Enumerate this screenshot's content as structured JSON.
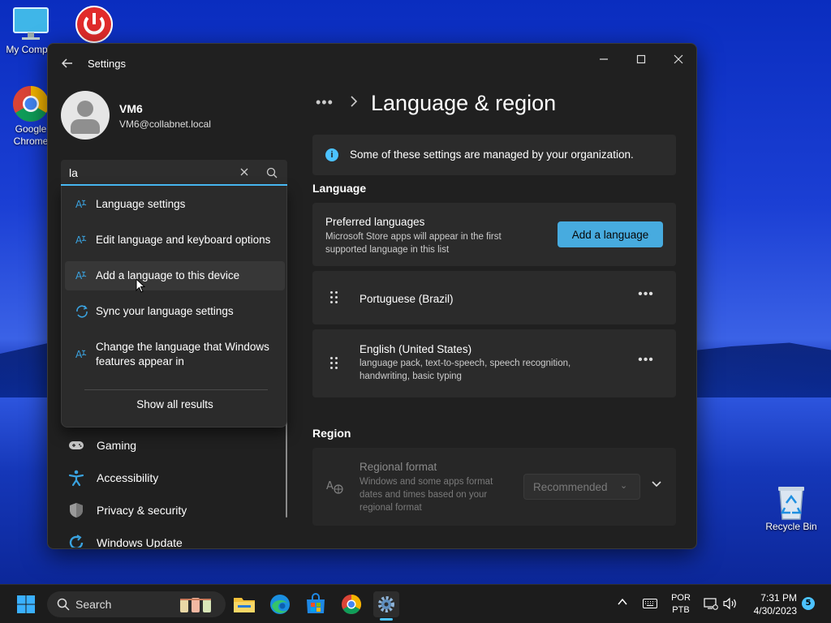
{
  "desktop": {
    "icons": [
      {
        "label": "My Comput"
      },
      {
        "label": "Google\nChrome"
      },
      {
        "label": "Recycle Bin"
      }
    ]
  },
  "window": {
    "title": "Settings",
    "user": {
      "name": "VM6",
      "email": "VM6@collabnet.local"
    },
    "search": {
      "value": "la"
    },
    "suggestions": [
      {
        "label": "Language settings"
      },
      {
        "label": "Edit language and keyboard options"
      },
      {
        "label": "Add a language to this device"
      },
      {
        "label": "Sync your language settings"
      },
      {
        "label": "Change the language that Windows features appear in"
      }
    ],
    "show_all": "Show all results",
    "nav": [
      {
        "label": "Gaming",
        "icon": "gamepad-icon"
      },
      {
        "label": "Accessibility",
        "icon": "accessibility-icon"
      },
      {
        "label": "Privacy & security",
        "icon": "shield-icon"
      },
      {
        "label": "Windows Update",
        "icon": "update-icon"
      }
    ]
  },
  "main": {
    "breadcrumb_more": "•••",
    "title": "Language & region",
    "info": "Some of these settings are managed by your organization.",
    "language_section": "Language",
    "preferred": {
      "title": "Preferred languages",
      "desc": "Microsoft Store apps will appear in the first supported language in this list",
      "button": "Add a language"
    },
    "languages": [
      {
        "name": "Portuguese (Brazil)",
        "desc": ""
      },
      {
        "name": "English (United States)",
        "desc": "language pack, text-to-speech, speech recognition, handwriting, basic typing"
      }
    ],
    "region_section": "Region",
    "regional_format": {
      "title": "Regional format",
      "desc": "Windows and some apps format dates and times based on your regional format",
      "value": "Recommended"
    }
  },
  "taskbar": {
    "search_label": "Search",
    "lang_line1": "POR",
    "lang_line2": "PTB",
    "time": "7:31 PM",
    "date": "4/30/2023",
    "notifications": "5"
  },
  "colors": {
    "accent": "#4cc2ff",
    "window_bg": "#202020",
    "card_bg": "#2b2b2b"
  }
}
